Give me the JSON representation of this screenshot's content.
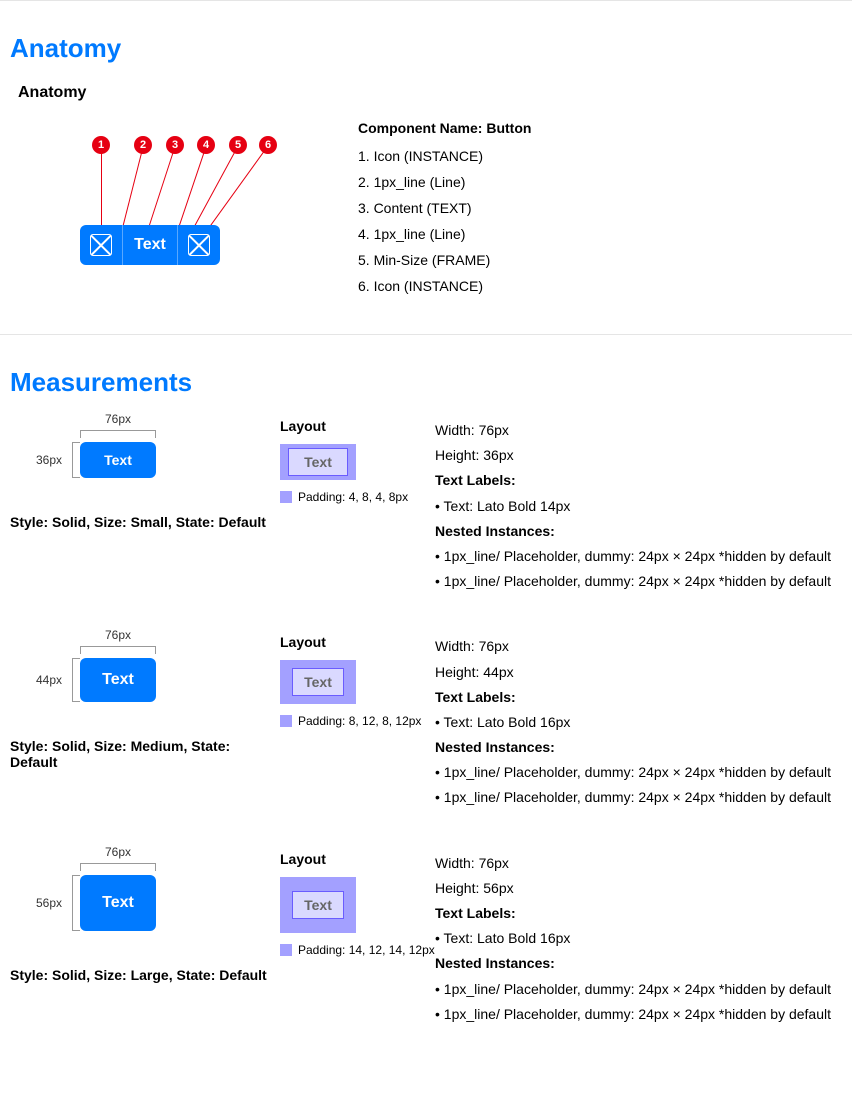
{
  "anatomy": {
    "heading": "Anatomy",
    "sub": "Anatomy",
    "componentName": "Component Name: Button",
    "items": [
      "1. Icon (INSTANCE)",
      "2. 1px_line (Line)",
      "3. Content (TEXT)",
      "4. 1px_line (Line)",
      "5. Min-Size (FRAME)",
      "6. Icon (INSTANCE)"
    ],
    "btnText": "Text",
    "markers": [
      "1",
      "2",
      "3",
      "4",
      "5",
      "6"
    ]
  },
  "measurements": {
    "heading": "Measurements",
    "rows": [
      {
        "wLabel": "76px",
        "hLabel": "36px",
        "btnText": "Text",
        "btnW": 76,
        "btnH": 36,
        "btnFz": 14,
        "layoutLabel": "Layout",
        "pad": [
          4,
          8,
          4,
          8
        ],
        "legend": "Padding: 4, 8, 4, 8px",
        "style": "Style: Solid, Size: Small, State: Default",
        "details": [
          {
            "b": false,
            "t": "Width: 76px"
          },
          {
            "b": false,
            "t": "Height: 36px"
          },
          {
            "b": true,
            "t": "Text Labels:"
          },
          {
            "b": false,
            "t": "• Text: Lato Bold 14px"
          },
          {
            "b": true,
            "t": "Nested Instances:"
          },
          {
            "b": false,
            "t": "• 1px_line/ Placeholder, dummy: 24px × 24px *hidden by default"
          },
          {
            "b": false,
            "t": "• 1px_line/ Placeholder, dummy: 24px × 24px *hidden by default"
          }
        ]
      },
      {
        "wLabel": "76px",
        "hLabel": "44px",
        "btnText": "Text",
        "btnW": 76,
        "btnH": 44,
        "btnFz": 16,
        "layoutLabel": "Layout",
        "pad": [
          8,
          12,
          8,
          12
        ],
        "legend": "Padding: 8, 12, 8, 12px",
        "style": "Style: Solid, Size: Medium, State: Default",
        "details": [
          {
            "b": false,
            "t": "Width: 76px"
          },
          {
            "b": false,
            "t": "Height: 44px"
          },
          {
            "b": true,
            "t": "Text Labels:"
          },
          {
            "b": false,
            "t": "• Text: Lato Bold 16px"
          },
          {
            "b": true,
            "t": "Nested Instances:"
          },
          {
            "b": false,
            "t": "• 1px_line/ Placeholder, dummy: 24px × 24px *hidden by default"
          },
          {
            "b": false,
            "t": "• 1px_line/ Placeholder, dummy: 24px × 24px *hidden by default"
          }
        ]
      },
      {
        "wLabel": "76px",
        "hLabel": "56px",
        "btnText": "Text",
        "btnW": 76,
        "btnH": 56,
        "btnFz": 16,
        "layoutLabel": "Layout",
        "pad": [
          14,
          12,
          14,
          12
        ],
        "legend": "Padding: 14, 12, 14, 12px",
        "style": "Style: Solid, Size: Large, State: Default",
        "details": [
          {
            "b": false,
            "t": "Width: 76px"
          },
          {
            "b": false,
            "t": "Height: 56px"
          },
          {
            "b": true,
            "t": "Text Labels:"
          },
          {
            "b": false,
            "t": "• Text: Lato Bold 16px"
          },
          {
            "b": true,
            "t": "Nested Instances:"
          },
          {
            "b": false,
            "t": "• 1px_line/ Placeholder, dummy: 24px × 24px *hidden by default"
          },
          {
            "b": false,
            "t": "• 1px_line/ Placeholder, dummy: 24px × 24px *hidden by default"
          }
        ]
      }
    ]
  }
}
